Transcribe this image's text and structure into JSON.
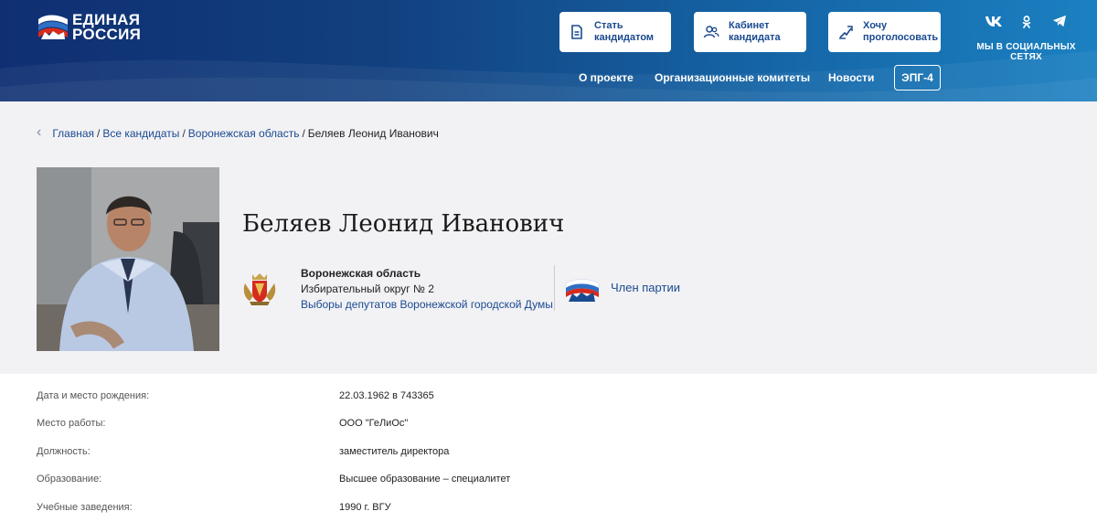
{
  "header": {
    "logo_line1": "ЕДИНАЯ",
    "logo_line2": "РОССИЯ",
    "buttons": [
      {
        "icon": "document-icon",
        "label": "Стать кандидатом"
      },
      {
        "icon": "users-icon",
        "label": "Кабинет кандидата"
      },
      {
        "icon": "vote-hand-icon",
        "label": "Хочу проголосовать"
      }
    ],
    "social": {
      "vk": "vk",
      "ok": "ok",
      "telegram": "telegram",
      "label": "МЫ В СОЦИАЛЬНЫХ СЕТЯХ"
    },
    "nav": [
      "О проекте",
      "Организационные комитеты",
      "Новости"
    ],
    "epg_label": "ЭПГ-4"
  },
  "breadcrumb": {
    "items": [
      "Главная",
      "Все кандидаты",
      "Воронежская область"
    ],
    "current": "Беляев Леонид Иванович"
  },
  "profile": {
    "name": "Беляев Леонид Иванович",
    "region": "Воронежская область",
    "district": "Избирательный округ № 2",
    "election": "Выборы депутатов Воронежской городской Думы",
    "party_status": "Член партии"
  },
  "info": [
    {
      "label": "Дата и место рождения:",
      "value": "22.03.1962 в 743365"
    },
    {
      "label": "Место работы:",
      "value": "ООО \"ГеЛиОс\""
    },
    {
      "label": "Должность:",
      "value": "заместитель директора"
    },
    {
      "label": "Образование:",
      "value": "Высшее образование – специалитет"
    },
    {
      "label": "Учебные заведения:",
      "value": "1990 г. ВГУ"
    }
  ],
  "colors": {
    "brand_blue": "#1a4a8f",
    "header_dark": "#0f2f72",
    "header_light": "#1b80c1",
    "flag_red": "#d52b1e"
  }
}
